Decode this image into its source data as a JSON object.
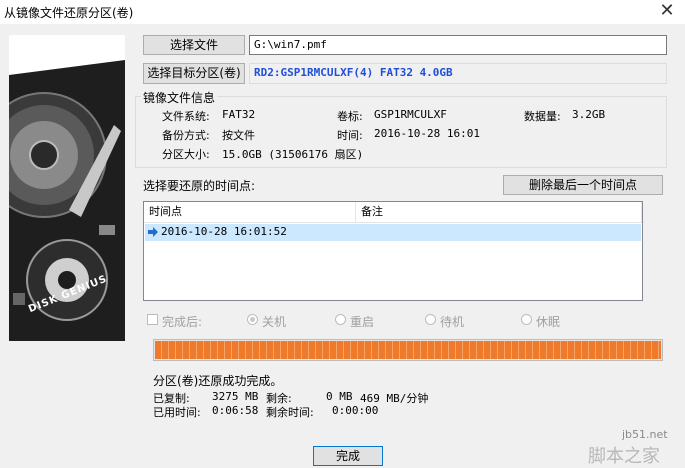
{
  "window": {
    "title": "从镜像文件还原分区(卷)",
    "close_glyph": "✕"
  },
  "source": {
    "select_file_label": "选择文件",
    "file_path": "G:\\win7.pmf",
    "select_target_label": "选择目标分区(卷)",
    "target_value": "RD2:GSP1RMCULXF(4) FAT32 4.0GB"
  },
  "image_info": {
    "group_title": "镜像文件信息",
    "fs_label": "文件系统:",
    "fs_value": "FAT32",
    "volume_label": "卷标:",
    "volume_value": "GSP1RMCULXF",
    "data_label": "数据量:",
    "data_value": "3.2GB",
    "backup_label": "备份方式:",
    "backup_value": "按文件",
    "time_label": "时间:",
    "time_value": "2016-10-28 16:01",
    "size_label": "分区大小:",
    "size_value": "15.0GB  (31506176 扇区)"
  },
  "timepoints": {
    "title": "选择要还原的时间点:",
    "delete_label": "删除最后一个时间点",
    "col_time": "时间点",
    "col_note": "备注",
    "rows": [
      {
        "time": "2016-10-28 16:01:52",
        "note": ""
      }
    ]
  },
  "after": {
    "label": "完成后:",
    "options": [
      "关机",
      "重启",
      "待机",
      "休眠"
    ],
    "selected": "关机"
  },
  "progress": {
    "percent": 100,
    "color": "#f07a2c"
  },
  "status": {
    "message": "分区(卷)还原成功完成。",
    "copied_label": "已复制:",
    "copied_value": "3275 MB",
    "remaining_label": "剩余:",
    "remaining_value": "0 MB",
    "speed_value": "469 MB/分钟",
    "elapsed_label": "已用时间:",
    "elapsed_value": "0:06:58",
    "remaining_time_label": "剩余时间:",
    "remaining_time_value": "0:00:00"
  },
  "footer": {
    "done_label": "完成"
  },
  "watermark": {
    "site": "jb51.net",
    "brand": "脚本之家"
  },
  "art": {
    "brand": "DISK GENIUS"
  },
  "colors": {
    "target_text": "#1f4fd8",
    "accent": "#0078d7"
  }
}
